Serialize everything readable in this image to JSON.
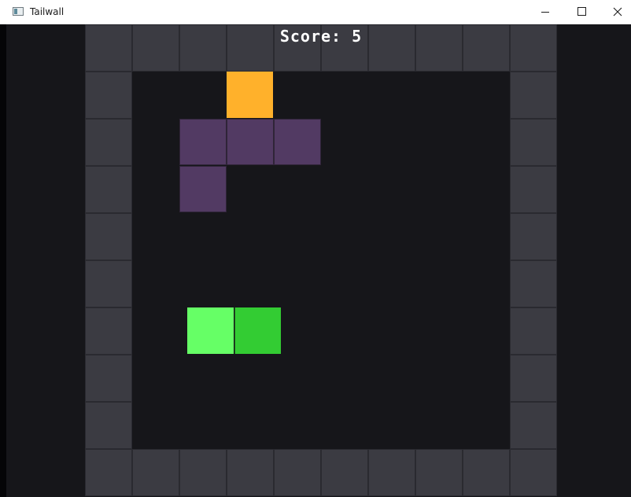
{
  "window": {
    "title": "Tailwall"
  },
  "caption": {
    "minimize_icon": "minimize-icon",
    "maximize_icon": "maximize-icon",
    "close_icon": "close-icon"
  },
  "game": {
    "score_text": "Score: 5",
    "grid_size": 10,
    "colors": {
      "wall": "#3b3b42",
      "floor": "#16161a",
      "food": "#ffb12b",
      "obstacle": "#523a63",
      "snake_head": "#66ff66",
      "snake_body": "#33cc33"
    },
    "food": {
      "col": 3,
      "row": 1
    },
    "obstacle": [
      {
        "col": 2,
        "row": 2
      },
      {
        "col": 3,
        "row": 2
      },
      {
        "col": 4,
        "row": 2
      },
      {
        "col": 2,
        "row": 3
      }
    ],
    "snake": [
      {
        "col": 2.17,
        "row": 6,
        "part": "head"
      },
      {
        "col": 3.17,
        "row": 6,
        "part": "body"
      }
    ]
  }
}
